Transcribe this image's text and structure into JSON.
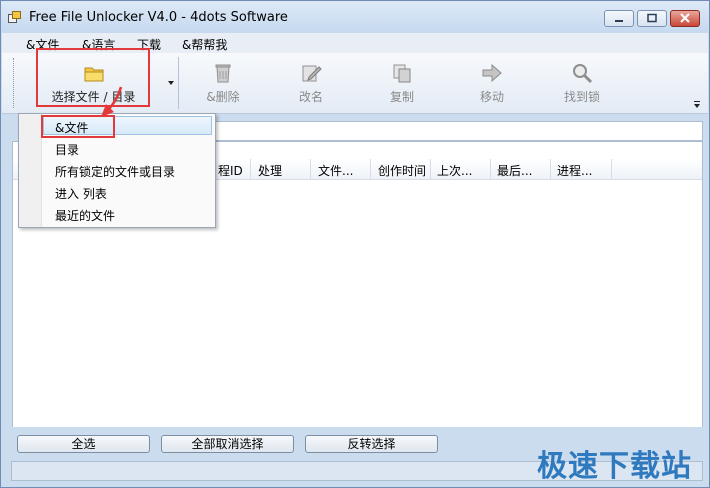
{
  "window": {
    "title": "Free File Unlocker V4.0 - 4dots Software"
  },
  "menu": [
    "&文件",
    "&语言",
    "下载",
    "&帮帮我"
  ],
  "toolbar": {
    "select_button": "选择文件 / 目录",
    "buttons": [
      {
        "label": "&删除",
        "icon": "recycle-bin-icon"
      },
      {
        "label": "改名",
        "icon": "rename-icon"
      },
      {
        "label": "复制",
        "icon": "copy-icon"
      },
      {
        "label": "移动",
        "icon": "arrow-right-icon"
      },
      {
        "label": "找到锁",
        "icon": "search-icon"
      }
    ]
  },
  "dropdown": {
    "items": [
      "&文件",
      "目录",
      "所有锁定的文件或目录",
      "进入 列表",
      "最近的文件"
    ],
    "highlighted": "&文件"
  },
  "columns": [
    "程ID",
    "处理",
    "文件...",
    "创作时间",
    "上次...",
    "最后...",
    "进程..."
  ],
  "bottom_buttons": [
    "全选",
    "全部取消选择",
    "反转选择"
  ],
  "watermark": "极速下载站",
  "colors": {
    "highlight_box": "#e23a3a",
    "watermark": "#2f79bf"
  }
}
